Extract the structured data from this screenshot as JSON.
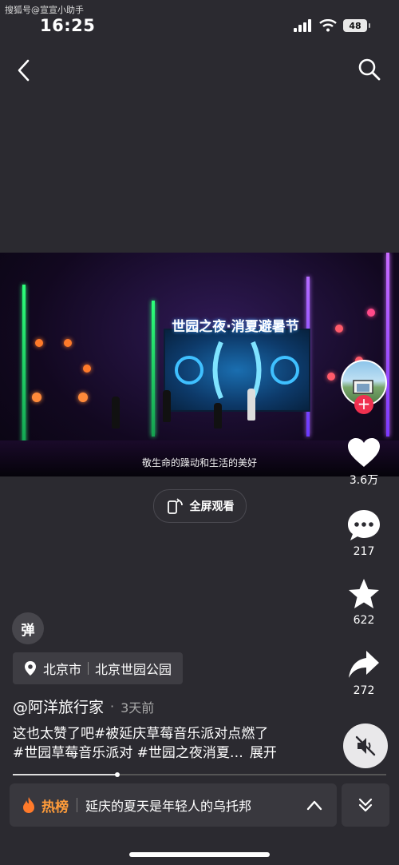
{
  "watermark": "搜狐号@宣宣小助手",
  "status": {
    "time": "16:25",
    "battery": "48"
  },
  "video": {
    "stage_title": "世园之夜·消夏避暑节",
    "subtitle": "敬生命的躁动和生活的美好"
  },
  "fullscreen": {
    "label": "全屏观看"
  },
  "actions": {
    "likes": "3.6万",
    "comments": "217",
    "favorites": "622",
    "shares": "272"
  },
  "danmu": {
    "label": "弹"
  },
  "location": {
    "city": "北京市",
    "place": "北京世园公园"
  },
  "author": {
    "name": "@阿洋旅行家",
    "separator": "·",
    "time_ago": "3天前"
  },
  "caption": {
    "line1": "这也太赞了吧#被延庆草莓音乐派对点燃了",
    "line2": "#世园草莓音乐派对 #世园之夜消夏…",
    "more": "展开"
  },
  "progress": {
    "fraction": 0.28
  },
  "hot": {
    "label": "热榜",
    "text": "延庆的夏天是年轻人的乌托邦"
  },
  "colors": {
    "accent_red": "#f0304f",
    "hot_orange": "#ff9c3a"
  }
}
